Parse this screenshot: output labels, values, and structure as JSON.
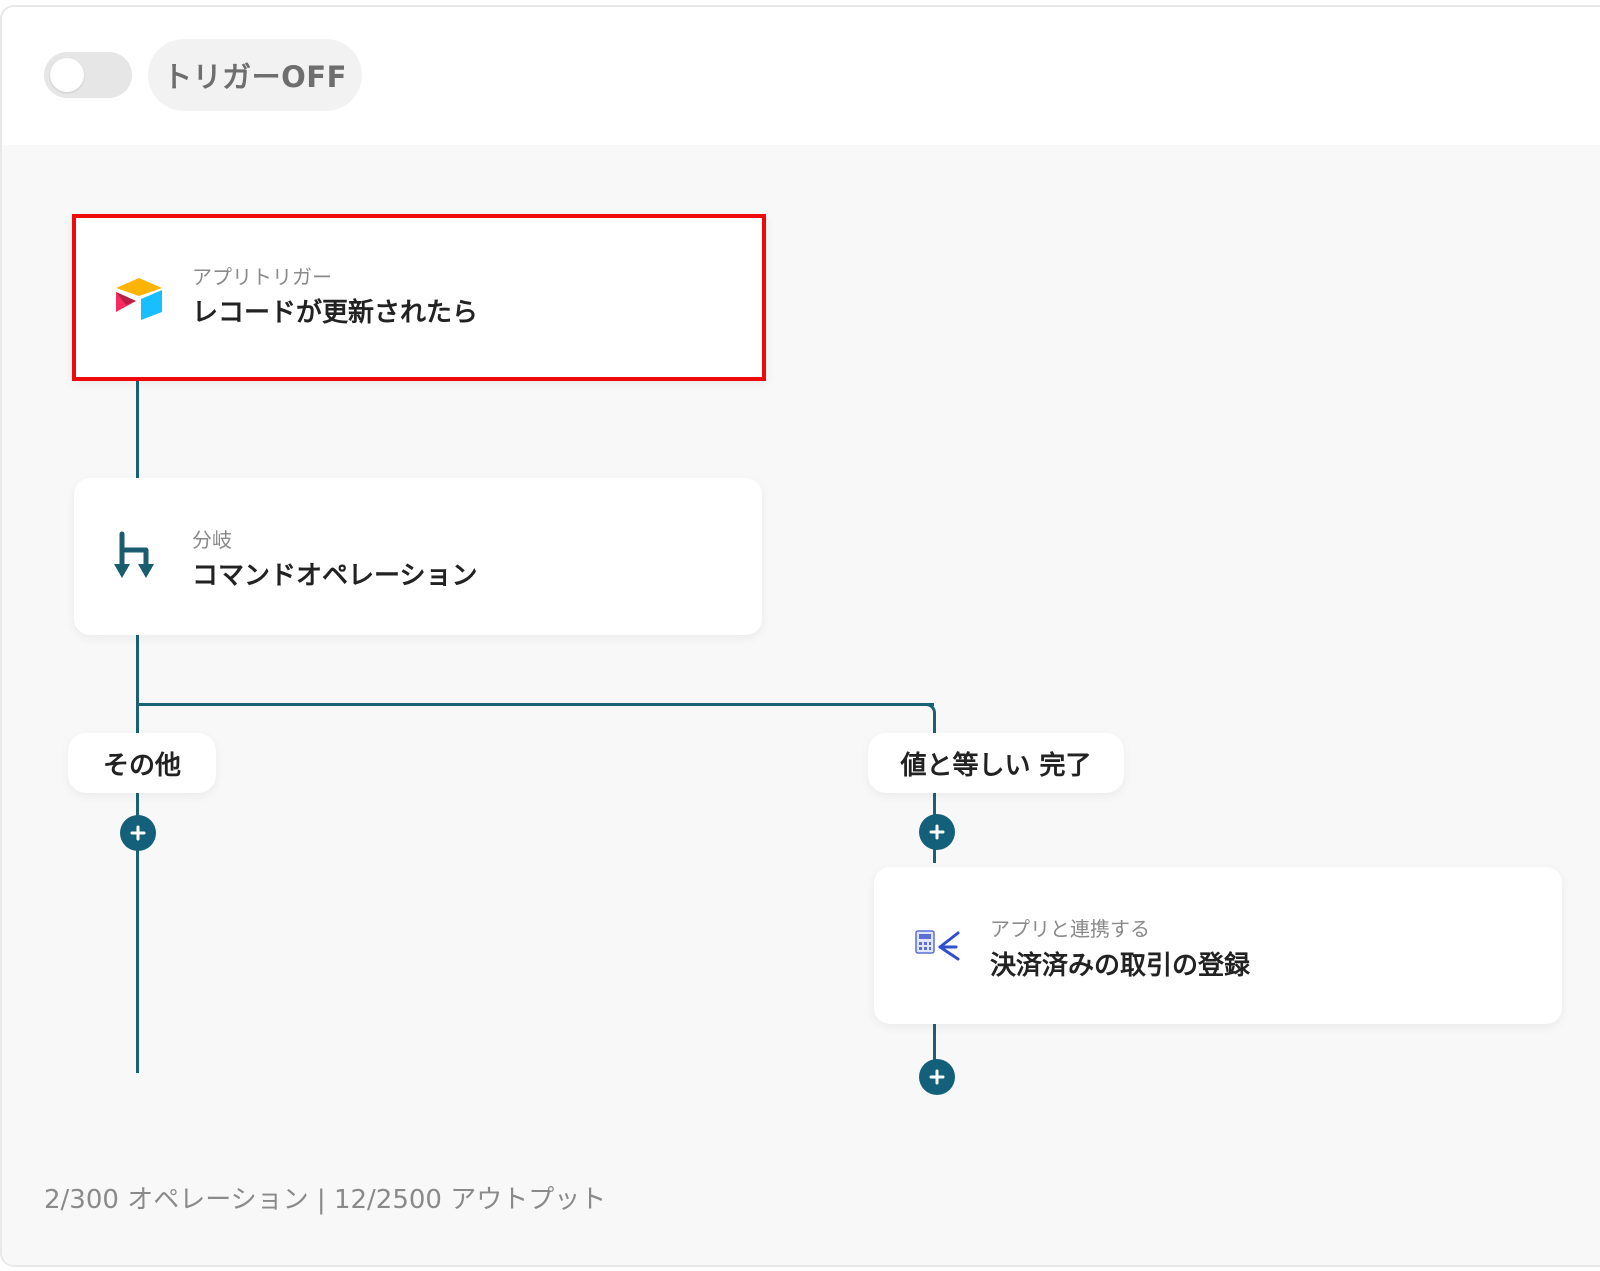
{
  "header": {
    "trigger_label": "トリガーOFF"
  },
  "flow": {
    "trigger_card": {
      "subtitle": "アプリトリガー",
      "title": "レコードが更新されたら"
    },
    "branch_card": {
      "subtitle": "分岐",
      "title": "コマンドオペレーション"
    },
    "branch_labels": {
      "other": "その他",
      "equal": "値と等しい 完了"
    },
    "action_card": {
      "subtitle": "アプリと連携する",
      "title": "決済済みの取引の登録"
    }
  },
  "footer": {
    "usage": "2/300 オペレーション | 12/2500 アウトプット"
  },
  "colors": {
    "connector": "#1a6175",
    "selected_border": "#ee0a0a",
    "plus_button": "#14607a"
  },
  "icons": {
    "toggle": "toggle-switch-off",
    "trigger_app": "airtable-logo-icon",
    "branch": "branch-arrows-icon",
    "action_app": "accounting-app-icon",
    "add": "plus-icon"
  }
}
